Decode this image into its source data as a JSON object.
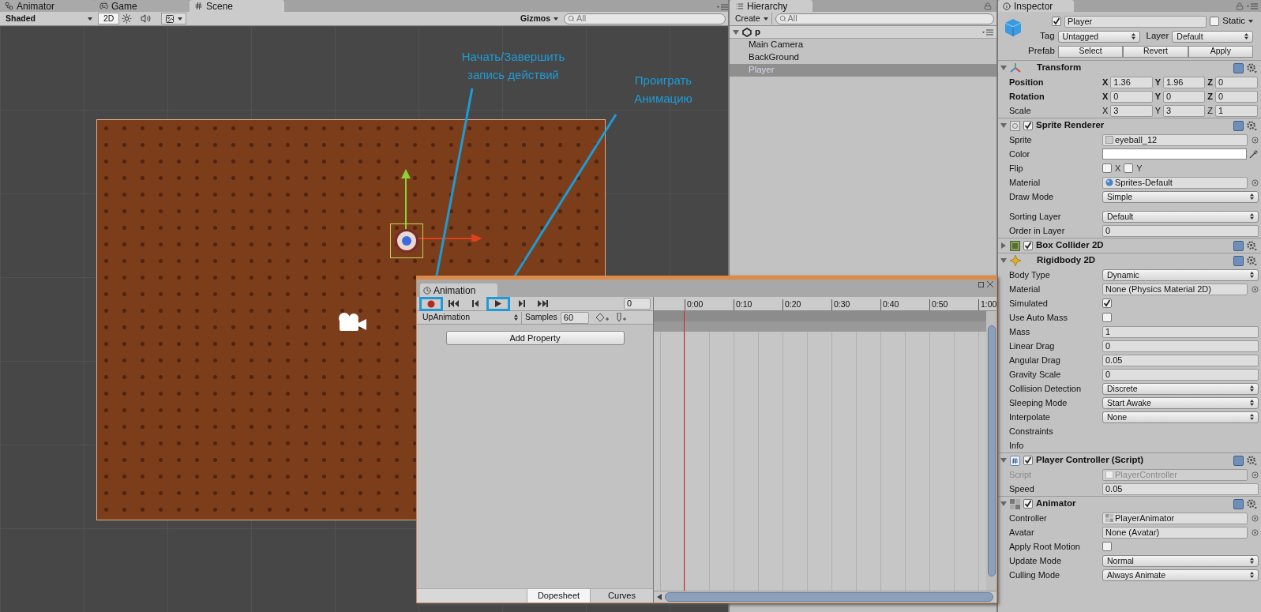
{
  "scene_tabs": [
    {
      "label": "Animator",
      "kind": "animator",
      "selected": false
    },
    {
      "label": "Game",
      "kind": "game",
      "selected": false
    },
    {
      "label": "Scene",
      "kind": "scene",
      "selected": true
    }
  ],
  "scene_toolbar": {
    "shading": "Shaded",
    "mode_2d": "2D",
    "mode_2d_on": true,
    "gizmos": "Gizmos",
    "search_placeholder": "All"
  },
  "annotations": [
    {
      "text": "Начать/Завершить запись действий"
    },
    {
      "text": "Проиграть Анимацию"
    }
  ],
  "hierarchy": {
    "title": "Hierarchy",
    "create": "Create",
    "search_placeholder": "All",
    "root": {
      "name": "p",
      "expanded": true,
      "children": [
        {
          "name": "Main Camera",
          "selected": false
        },
        {
          "name": "BackGround",
          "selected": false
        },
        {
          "name": "Player",
          "selected": true
        }
      ]
    }
  },
  "inspector": {
    "title": "Inspector",
    "active": true,
    "name": "Player",
    "static_label": "Static",
    "static": false,
    "tag_label": "Tag",
    "tag": "Untagged",
    "layer_label": "Layer",
    "layer": "Default",
    "prefab_label": "Prefab",
    "prefab_buttons": [
      "Select",
      "Revert",
      "Apply"
    ],
    "components": [
      {
        "title": "Transform",
        "kind": "transform",
        "expanded": true,
        "rows": [
          {
            "kind": "vector",
            "label": "Position",
            "bold": true,
            "values": [
              {
                "axis": "X",
                "value": "1.36"
              },
              {
                "axis": "Y",
                "value": "1.96"
              },
              {
                "axis": "Z",
                "value": "0"
              }
            ]
          },
          {
            "kind": "vector",
            "label": "Rotation",
            "bold": true,
            "values": [
              {
                "axis": "X",
                "value": "0"
              },
              {
                "axis": "Y",
                "value": "0"
              },
              {
                "axis": "Z",
                "value": "0"
              }
            ]
          },
          {
            "kind": "vector",
            "label": "Scale",
            "bold": false,
            "values": [
              {
                "axis": "X",
                "value": "3"
              },
              {
                "axis": "Y",
                "value": "3"
              },
              {
                "axis": "Z",
                "value": "1"
              }
            ]
          }
        ]
      },
      {
        "title": "Sprite Renderer",
        "kind": "sprite",
        "enabled": true,
        "expanded": true,
        "rows": [
          {
            "kind": "object",
            "label": "Sprite",
            "value": {
              "kind": "sprite",
              "text": "eyeball_12"
            }
          },
          {
            "kind": "color",
            "label": "Color",
            "color": "#ffffff"
          },
          {
            "kind": "flip",
            "label": "Flip",
            "options": [
              {
                "label": "X",
                "checked": false
              },
              {
                "label": "Y",
                "checked": false
              }
            ]
          },
          {
            "kind": "object",
            "label": "Material",
            "value": {
              "kind": "material",
              "text": "Sprites-Default"
            }
          },
          {
            "kind": "dropdown",
            "label": "Draw Mode",
            "value": "Simple"
          },
          {
            "kind": "dropdown",
            "label": "Sorting Layer",
            "value": "Default",
            "gap_before": true
          },
          {
            "kind": "text",
            "label": "Order in Layer",
            "value": "0"
          }
        ]
      },
      {
        "title": "Box Collider 2D",
        "kind": "collider",
        "enabled": true,
        "expanded": false
      },
      {
        "title": "Rigidbody 2D",
        "kind": "rigidbody",
        "expanded": true,
        "rows": [
          {
            "kind": "dropdown",
            "label": "Body Type",
            "value": "Dynamic"
          },
          {
            "kind": "object",
            "label": "Material",
            "value": {
              "kind": "none",
              "text": "None (Physics Material 2D)"
            }
          },
          {
            "kind": "checkbox",
            "label": "Simulated",
            "checked": true
          },
          {
            "kind": "checkbox",
            "label": "Use Auto Mass",
            "checked": false
          },
          {
            "kind": "text",
            "label": "Mass",
            "value": "1"
          },
          {
            "kind": "text",
            "label": "Linear Drag",
            "value": "0"
          },
          {
            "kind": "text",
            "label": "Angular Drag",
            "value": "0.05"
          },
          {
            "kind": "text",
            "label": "Gravity Scale",
            "value": "0"
          },
          {
            "kind": "dropdown",
            "label": "Collision Detection",
            "value": "Discrete"
          },
          {
            "kind": "dropdown",
            "label": "Sleeping Mode",
            "value": "Start Awake"
          },
          {
            "kind": "dropdown",
            "label": "Interpolate",
            "value": "None"
          },
          {
            "kind": "label",
            "label": "Constraints"
          },
          {
            "kind": "label",
            "label": "Info"
          }
        ]
      },
      {
        "title": "Player Controller (Script)",
        "kind": "script",
        "enabled": true,
        "expanded": true,
        "rows": [
          {
            "kind": "object",
            "label": "Script",
            "value": {
              "kind": "script",
              "text": "PlayerController"
            },
            "disabled": true
          },
          {
            "kind": "text",
            "label": "Speed",
            "value": "0.05"
          }
        ]
      },
      {
        "title": "Animator",
        "kind": "animator",
        "enabled": true,
        "expanded": true,
        "rows": [
          {
            "kind": "object",
            "label": "Controller",
            "value": {
              "kind": "controller",
              "text": "PlayerAnimator"
            }
          },
          {
            "kind": "object",
            "label": "Avatar",
            "value": {
              "kind": "none",
              "text": "None (Avatar)"
            }
          },
          {
            "kind": "checkbox",
            "label": "Apply Root Motion",
            "checked": false
          },
          {
            "kind": "dropdown",
            "label": "Update Mode",
            "value": "Normal"
          },
          {
            "kind": "dropdown",
            "label": "Culling Mode",
            "value": "Always Animate"
          }
        ]
      }
    ]
  },
  "animation": {
    "title": "Animation",
    "buttons": [
      {
        "kind": "record",
        "highlighted": true
      },
      {
        "kind": "first",
        "highlighted": false
      },
      {
        "kind": "prev",
        "highlighted": false
      },
      {
        "kind": "play",
        "highlighted": true
      },
      {
        "kind": "next",
        "highlighted": false
      },
      {
        "kind": "last",
        "highlighted": false
      }
    ],
    "frame": "0",
    "clip": "UpAnimation",
    "samples_label": "Samples",
    "samples": "60",
    "add_property": "Add Property",
    "ticks": [
      "0:00",
      "0:10",
      "0:20",
      "0:30",
      "0:40",
      "0:50",
      "1:00"
    ],
    "view_tabs": [
      {
        "label": "Dopesheet",
        "selected": true
      },
      {
        "label": "Curves",
        "selected": false
      }
    ]
  }
}
